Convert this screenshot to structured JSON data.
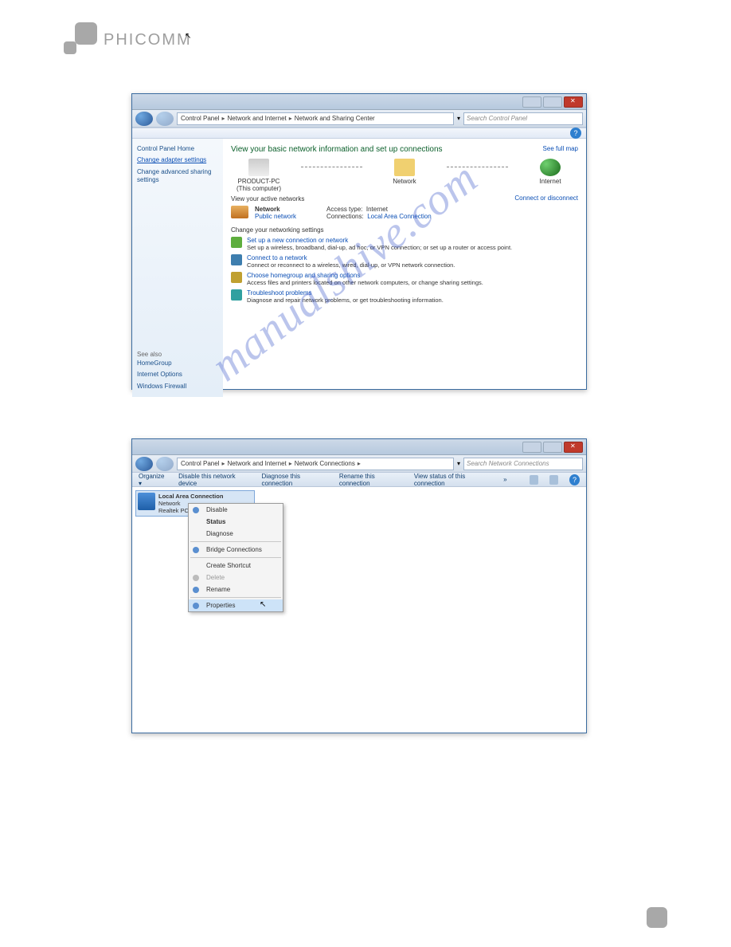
{
  "brand": "PHICOMM",
  "watermark": "manualshive.com",
  "win1": {
    "title_buttons": [
      "min",
      "max",
      "close"
    ],
    "breadcrumb": [
      "Control Panel",
      "Network and Internet",
      "Network and Sharing Center"
    ],
    "search_placeholder": "Search Control Panel",
    "sidebar": {
      "home": "Control Panel Home",
      "link1": "Change adapter settings",
      "link2": "Change advanced sharing settings",
      "seealso_label": "See also",
      "seealso": [
        "HomeGroup",
        "Internet Options",
        "Windows Firewall"
      ]
    },
    "main": {
      "heading": "View your basic network information and set up connections",
      "see_full_map": "See full map",
      "node_pc": "PRODUCT-PC",
      "node_pc_sub": "(This computer)",
      "node_net": "Network",
      "node_inet": "Internet",
      "active_label": "View your active networks",
      "conn_disc": "Connect or disconnect",
      "network_name": "Network",
      "network_type": "Public network",
      "access_label": "Access type:",
      "access_value": "Internet",
      "conn_label": "Connections:",
      "conn_value": "Local Area Connection",
      "change_heading": "Change your networking settings",
      "tasks": [
        {
          "title": "Set up a new connection or network",
          "desc": "Set up a wireless, broadband, dial-up, ad hoc, or VPN connection; or set up a router or access point."
        },
        {
          "title": "Connect to a network",
          "desc": "Connect or reconnect to a wireless, wired, dial-up, or VPN network connection."
        },
        {
          "title": "Choose homegroup and sharing options",
          "desc": "Access files and printers located on other network computers, or change sharing settings."
        },
        {
          "title": "Troubleshoot problems",
          "desc": "Diagnose and repair network problems, or get troubleshooting information."
        }
      ]
    }
  },
  "win2": {
    "breadcrumb": [
      "Control Panel",
      "Network and Internet",
      "Network Connections"
    ],
    "search_placeholder": "Search Network Connections",
    "toolbar": [
      "Organize ▾",
      "Disable this network device",
      "Diagnose this connection",
      "Rename this connection",
      "View status of this connection",
      "»"
    ],
    "connection": {
      "name": "Local Area Connection",
      "line2": "Network",
      "line3": "Realtek PCIe FE..."
    },
    "context_menu": [
      {
        "label": "Disable",
        "icon": true
      },
      {
        "label": "Status",
        "bold": true
      },
      {
        "label": "Diagnose"
      },
      {
        "sep": true
      },
      {
        "label": "Bridge Connections",
        "icon": true
      },
      {
        "sep": true
      },
      {
        "label": "Create Shortcut"
      },
      {
        "label": "Delete",
        "disabled": true,
        "icon": true
      },
      {
        "label": "Rename",
        "icon": true
      },
      {
        "sep": true
      },
      {
        "label": "Properties",
        "icon": true,
        "highlight": true
      }
    ]
  }
}
